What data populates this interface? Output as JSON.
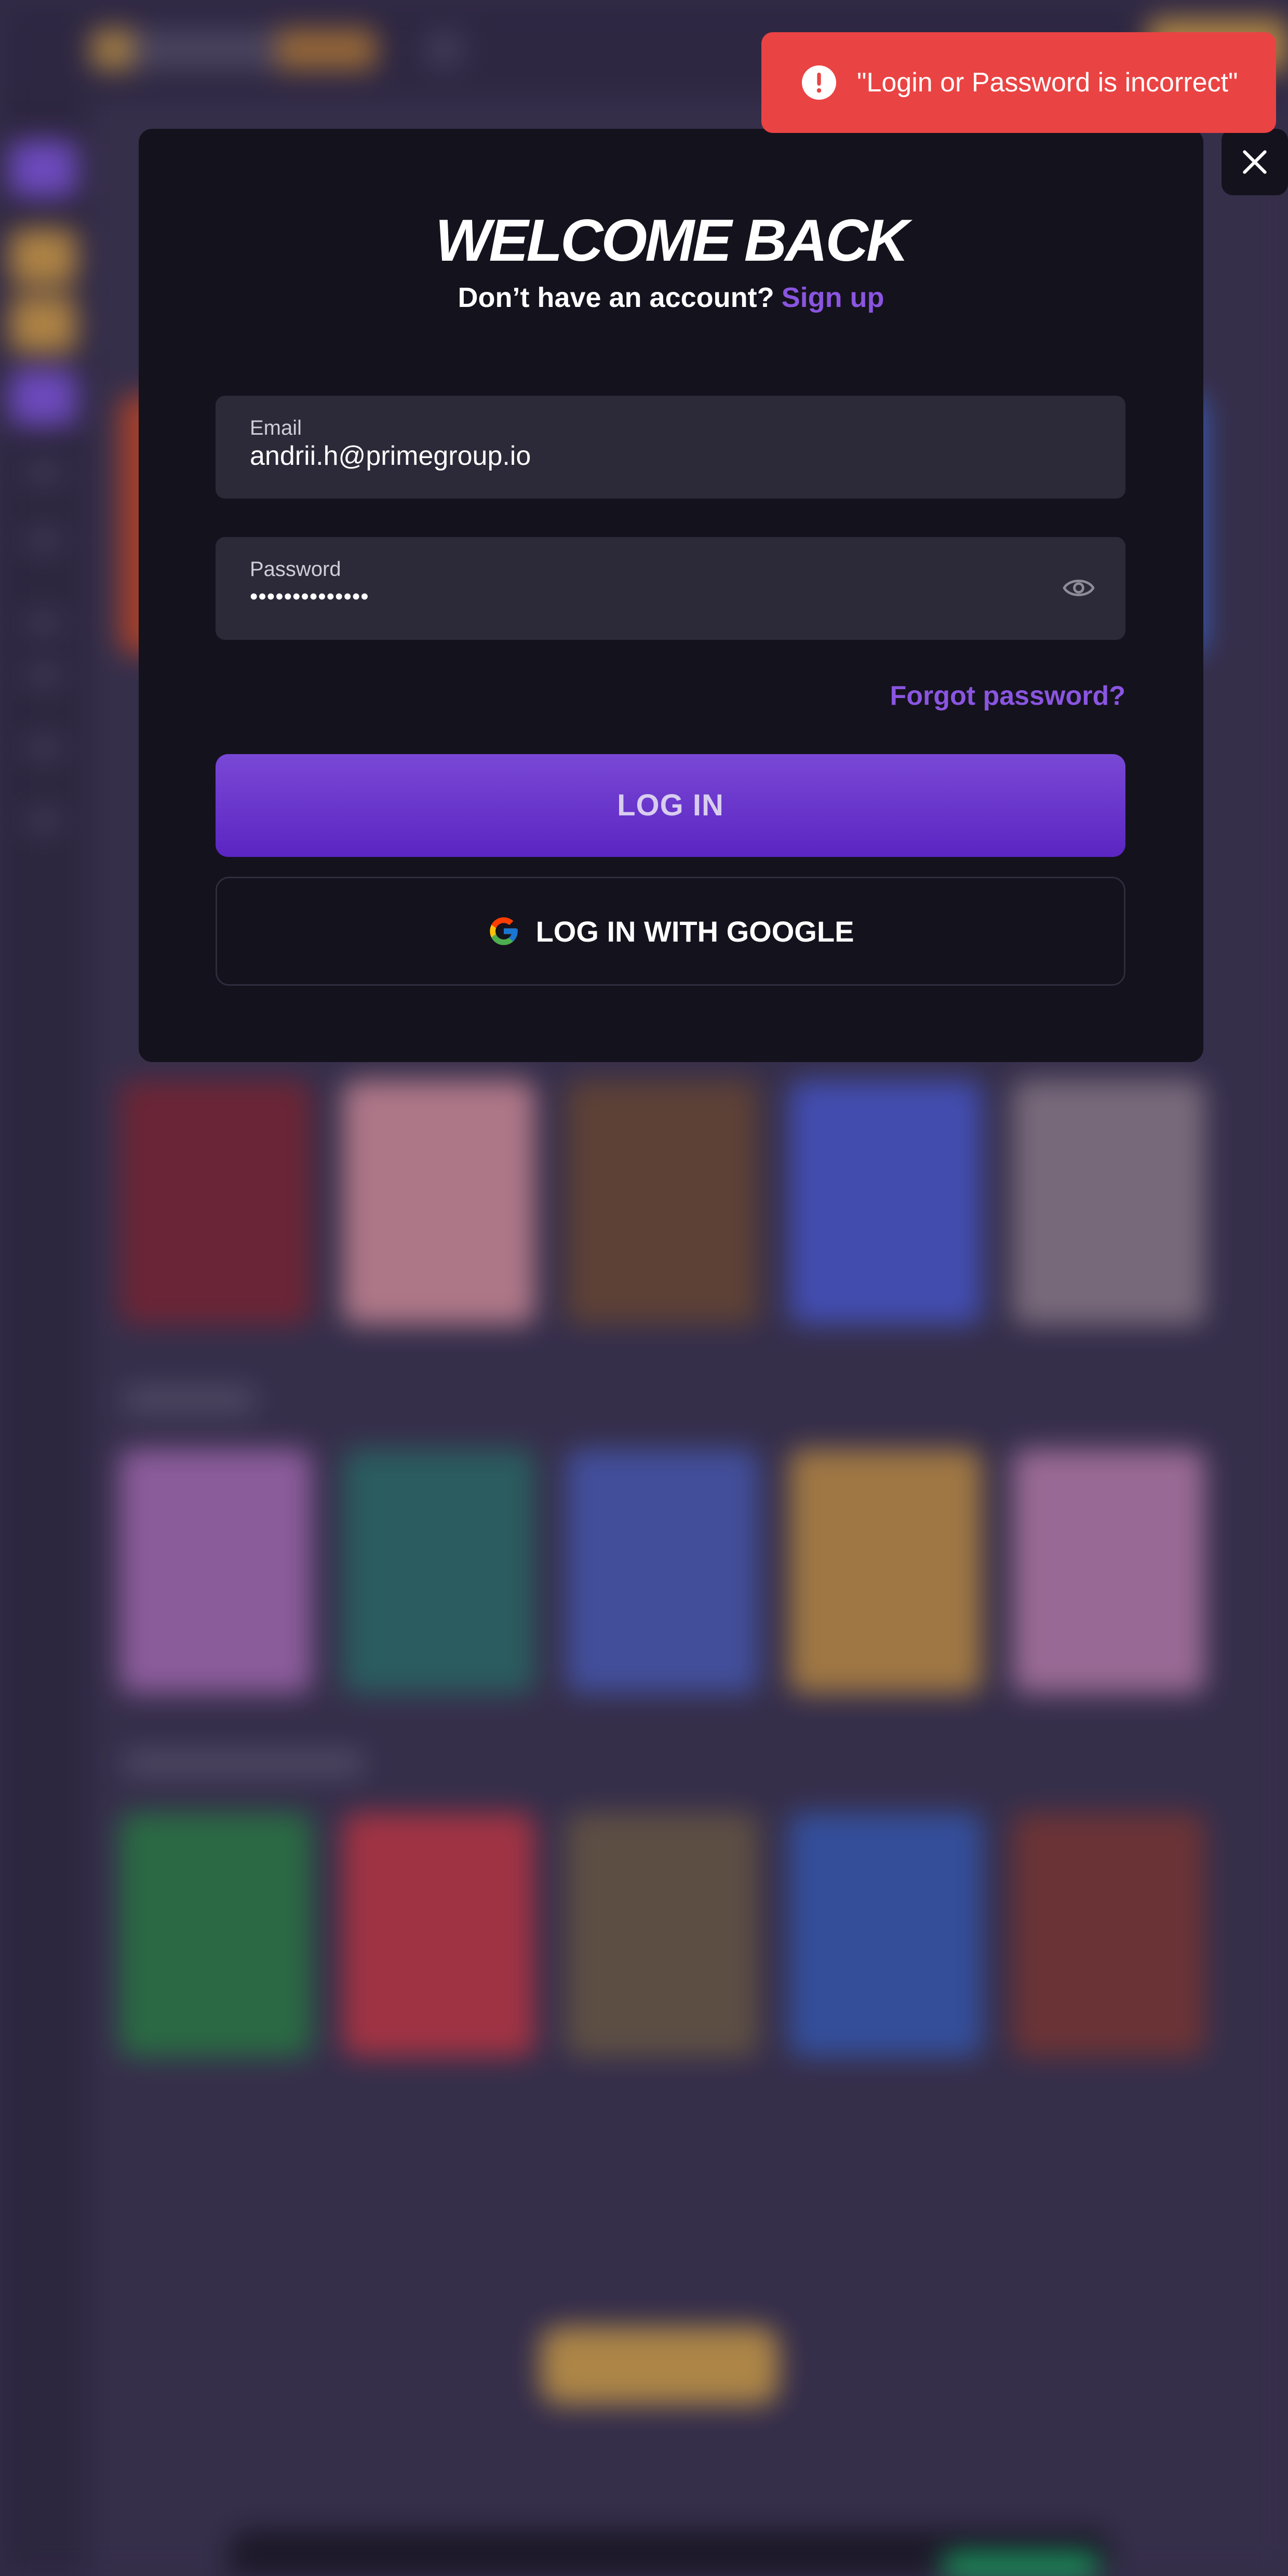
{
  "toast": {
    "icon": "error-icon",
    "message": "\"Login or Password is incorrect\"",
    "color": "#ea4343"
  },
  "modal": {
    "title": "WELCOME BACK",
    "signup_prompt": "Don’t have an account?",
    "signup_link": "Sign up",
    "email": {
      "label": "Email",
      "value": "andrii.h@primegroup.io"
    },
    "password": {
      "label": "Password",
      "value_masked": "••••••••••••••",
      "toggle_icon": "eye-icon"
    },
    "forgot_link": "Forgot password?",
    "login_button": "LOG IN",
    "google_button": "LOG IN WITH GOOGLE",
    "google_icon": "google-icon",
    "close_icon": "close-icon"
  },
  "colors": {
    "accent": "#8a55e0",
    "modal_bg": "#14121d",
    "field_bg": "#2c2a38",
    "error": "#ea4343"
  }
}
